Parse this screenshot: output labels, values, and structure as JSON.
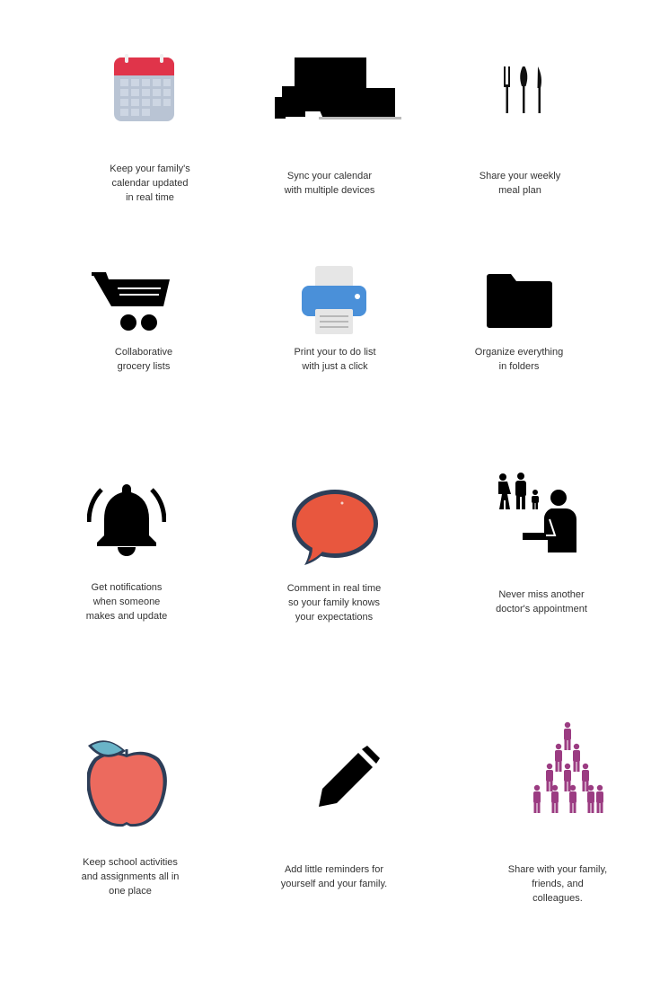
{
  "features": [
    {
      "caption": "Keep your family's\ncalendar updated\nin real time",
      "icon": "calendar-icon"
    },
    {
      "caption": "Sync your calendar\nwith multiple devices",
      "icon": "devices-icon"
    },
    {
      "caption": "Share your weekly\nmeal plan",
      "icon": "cutlery-icon"
    },
    {
      "caption": "Collaborative\ngrocery lists",
      "icon": "shopping-cart-icon"
    },
    {
      "caption": "Print your to do list\nwith just a click",
      "icon": "printer-icon"
    },
    {
      "caption": "Organize everything\nin folders",
      "icon": "folder-icon"
    },
    {
      "caption": "Get notifications\nwhen someone\nmakes and update",
      "icon": "bell-icon"
    },
    {
      "caption": "Comment in real time\nso your family knows\nyour expectations",
      "icon": "speech-bubble-icon"
    },
    {
      "caption": "Never miss another\ndoctor's appointment",
      "icon": "family-doctor-icon"
    },
    {
      "caption": "Keep school activities\nand assignments all in\none place",
      "icon": "apple-icon"
    },
    {
      "caption": "Add little reminders for\nyourself and your family.",
      "icon": "pencil-icon"
    },
    {
      "caption": "Share with your family,\nfriends, and colleagues.",
      "icon": "group-icon"
    }
  ],
  "colors": {
    "calendar_red": "#e0344a",
    "calendar_body": "#b9c4d4",
    "printer_blue": "#4a90d9",
    "bubble_orange": "#e8573e",
    "bubble_outline": "#2d3e58",
    "apple_red": "#ec6a5e",
    "apple_leaf": "#6ab4c8",
    "group_purple": "#9b3c82"
  }
}
